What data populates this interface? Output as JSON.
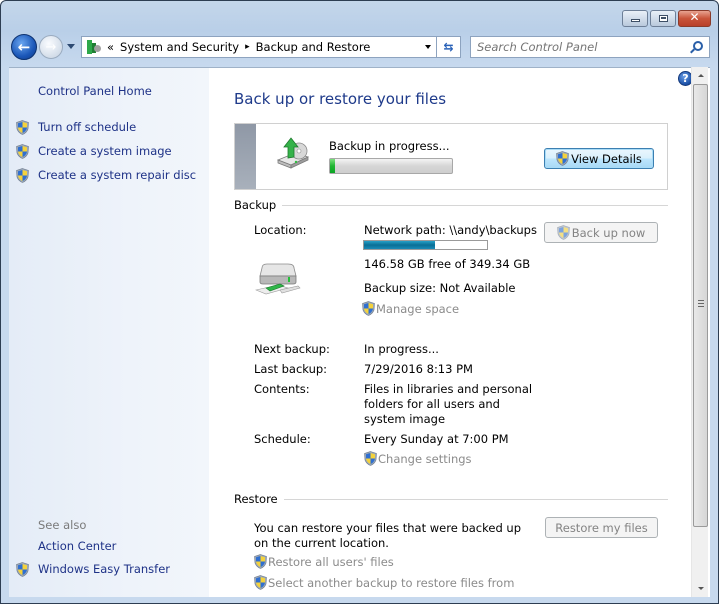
{
  "window": {
    "caption_buttons": {
      "minimize_icon": "minimize-icon",
      "maximize_icon": "maximize-icon",
      "close_icon": "close-icon",
      "close_glyph": "✕"
    }
  },
  "nav": {
    "back_glyph": "←",
    "forward_glyph": "→",
    "breadcrumb": {
      "overflow": "«",
      "items": [
        "System and Security",
        "Backup and Restore"
      ],
      "separator": "▸"
    },
    "refresh_glyph": "⇆",
    "search": {
      "placeholder": "Search Control Panel",
      "value": ""
    }
  },
  "sidebar": {
    "home": "Control Panel Home",
    "tasks": [
      {
        "label": "Turn off schedule",
        "icon": "uac-shield-icon"
      },
      {
        "label": "Create a system image",
        "icon": "uac-shield-icon"
      },
      {
        "label": "Create a system repair disc",
        "icon": "uac-shield-icon"
      }
    ],
    "see_also": {
      "title": "See also",
      "items": [
        {
          "label": "Action Center",
          "icon": null
        },
        {
          "label": "Windows Easy Transfer",
          "icon": "uac-shield-icon"
        }
      ]
    }
  },
  "main": {
    "help_glyph": "?",
    "title": "Back up or restore your files",
    "status": {
      "text": "Backup in progress...",
      "progress_percent": 4,
      "view_details_label": "View Details"
    },
    "backup": {
      "header": "Backup",
      "location_label": "Location:",
      "location_value": "Network path: \\\\andy\\backups",
      "disk_used_percent": 58,
      "free_space": "146.58 GB free of 349.34 GB",
      "backup_size": "Backup size: Not Available",
      "manage_space": "Manage space",
      "back_up_now": "Back up now",
      "next_backup_label": "Next backup:",
      "next_backup_value": "In progress...",
      "last_backup_label": "Last backup:",
      "last_backup_value": "7/29/2016 8:13 PM",
      "contents_label": "Contents:",
      "contents_value": "Files in libraries and personal folders for all users and system image",
      "schedule_label": "Schedule:",
      "schedule_value": "Every Sunday at 7:00 PM",
      "change_settings": "Change settings"
    },
    "restore": {
      "header": "Restore",
      "description": "You can restore your files that were backed up on the current location.",
      "restore_my_files": "Restore my files",
      "restore_all_users": "Restore all users' files",
      "select_another": "Select another backup to restore files from"
    }
  },
  "colors": {
    "link": "#1e3287",
    "title": "#1e3a8a",
    "disabled_text": "#8b8b8b",
    "progress_green": "#1fb532",
    "disk_bar_blue": "#0a6f96"
  }
}
